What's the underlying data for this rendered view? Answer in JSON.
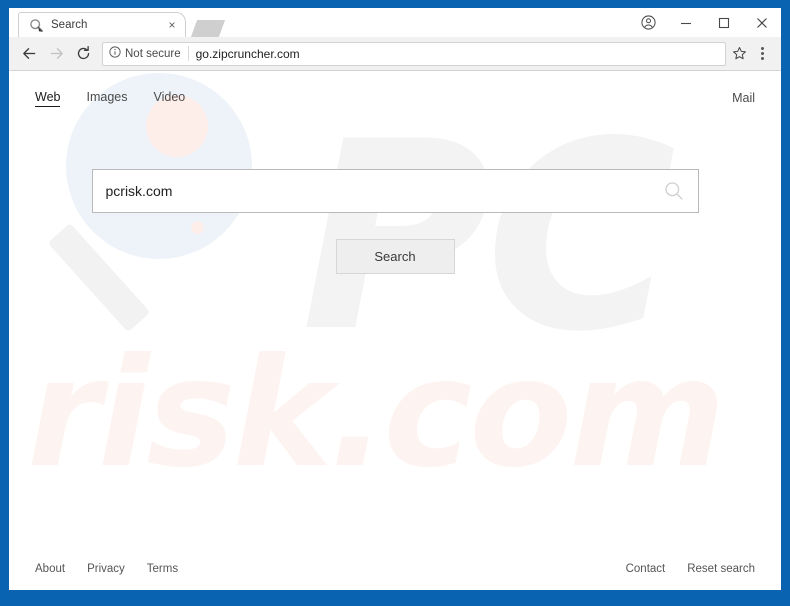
{
  "window": {
    "frame_color": "#0963b0",
    "controls": {
      "profile_icon": "profile-avatar-icon",
      "minimize_label": "Minimize",
      "maximize_label": "Maximize",
      "close_label": "Close"
    }
  },
  "tab_strip": {
    "tab": {
      "title": "Search",
      "favicon": "magnifier-icon",
      "close_label": "×"
    },
    "new_tab_label": "New tab"
  },
  "toolbar": {
    "back_label": "Back",
    "forward_label": "Forward",
    "reload_label": "Reload",
    "security_text": "Not secure",
    "security_icon": "info-circle-icon",
    "url": "go.zipcruncher.com",
    "bookmark_label": "Bookmark this page",
    "menu_label": "Customize and control"
  },
  "site": {
    "nav": {
      "left": [
        {
          "label": "Web",
          "active": true
        },
        {
          "label": "Images",
          "active": false
        },
        {
          "label": "Video",
          "active": false
        }
      ],
      "right": {
        "label": "Mail"
      }
    },
    "search": {
      "value": "pcrisk.com",
      "placeholder": "",
      "glass_icon": "search-icon",
      "button_label": "Search"
    },
    "watermarks": {
      "brand_top": "PC",
      "brand_bottom": "risk.com"
    },
    "footer": {
      "left": [
        {
          "label": "About"
        },
        {
          "label": "Privacy"
        },
        {
          "label": "Terms"
        }
      ],
      "right": [
        {
          "label": "Contact"
        },
        {
          "label": "Reset search"
        }
      ]
    }
  }
}
